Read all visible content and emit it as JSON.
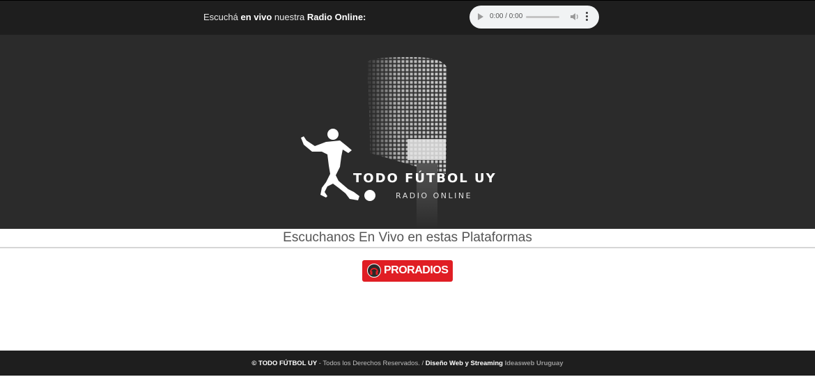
{
  "topbar": {
    "text_1": "Escuchá ",
    "text_2": "en vivo",
    "text_3": " nuestra ",
    "text_4": "Radio Online:",
    "player": {
      "time": "0:00 / 0:00"
    }
  },
  "hero": {
    "logo_title": "TODO FÚTBOL UY",
    "logo_subtitle": "RADIO ONLINE",
    "background_color": "#2b2b2b"
  },
  "platforms": {
    "title": "Escuchanos En Vivo en estas Plataformas",
    "proradios_label": "PRORADIOS",
    "accent_color": "#e01e24"
  },
  "footer": {
    "part_1": "© TODO FÚTBOL UY",
    "part_2": " - Todos los Derechos Reservados. / ",
    "part_3": "Diseño Web y Streaming",
    "part_4": " Ideasweb Uruguay"
  }
}
